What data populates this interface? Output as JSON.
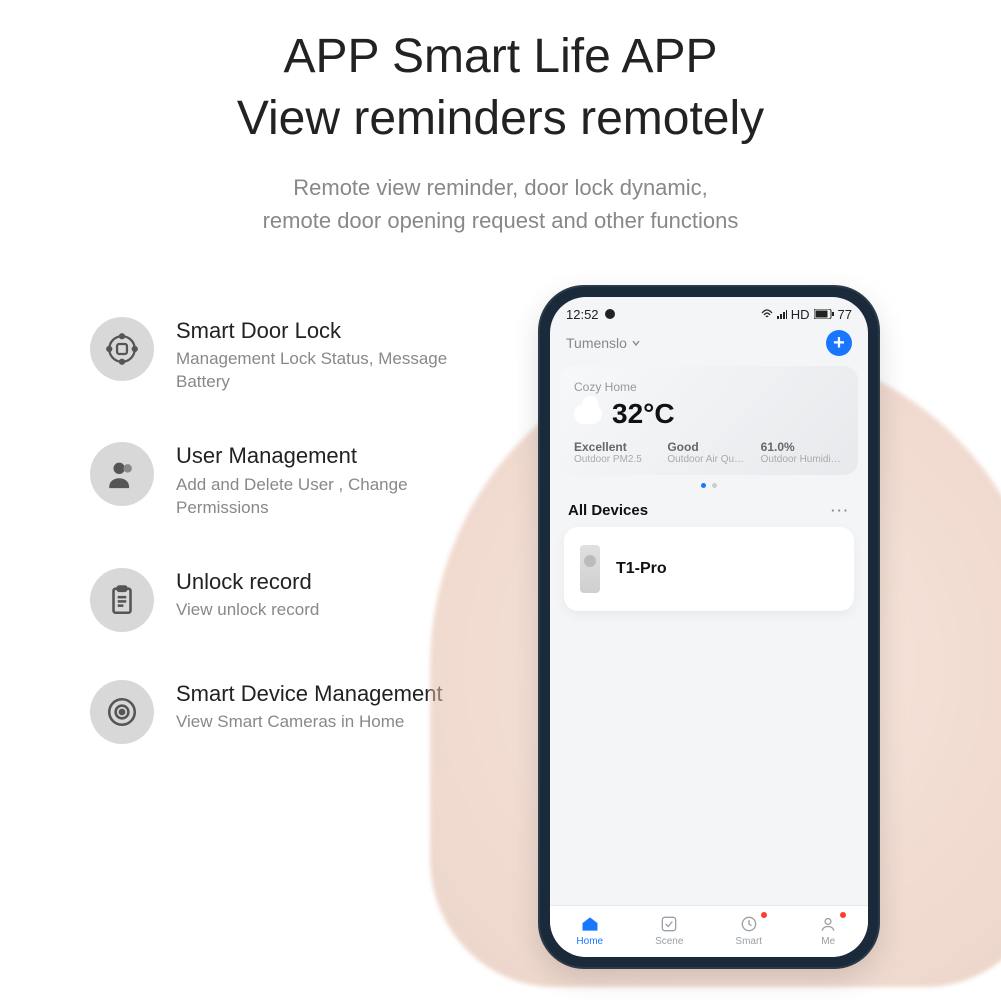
{
  "headline_line1": "APP Smart Life APP",
  "headline_line2": "View reminders remotely",
  "sub_line1": "Remote view reminder, door lock dynamic,",
  "sub_line2": "remote door opening request and other functions",
  "features": [
    {
      "title": "Smart Door Lock",
      "desc": "Management Lock Status, Message Battery"
    },
    {
      "title": "User Management",
      "desc": "Add and Delete User , Change Permissions"
    },
    {
      "title": "Unlock record",
      "desc": "View unlock record"
    },
    {
      "title": "Smart Device Management",
      "desc": "View Smart Cameras in Home"
    }
  ],
  "phone": {
    "statusbar": {
      "time": "12:52",
      "right_text": "HD",
      "battery": "77"
    },
    "header": {
      "location": "Tumenslo"
    },
    "weather": {
      "home_label": "Cozy Home",
      "temp": "32°C",
      "stats": [
        {
          "value": "Excellent",
          "label": "Outdoor PM2.5"
        },
        {
          "value": "Good",
          "label": "Outdoor Air Qu…"
        },
        {
          "value": "61.0%",
          "label": "Outdoor Humidi…"
        }
      ]
    },
    "section_title": "All Devices",
    "device_name": "T1-Pro",
    "tabs": [
      {
        "label": "Home",
        "active": true,
        "badge": false
      },
      {
        "label": "Scene",
        "active": false,
        "badge": false
      },
      {
        "label": "Smart",
        "active": false,
        "badge": true
      },
      {
        "label": "Me",
        "active": false,
        "badge": true
      }
    ]
  }
}
